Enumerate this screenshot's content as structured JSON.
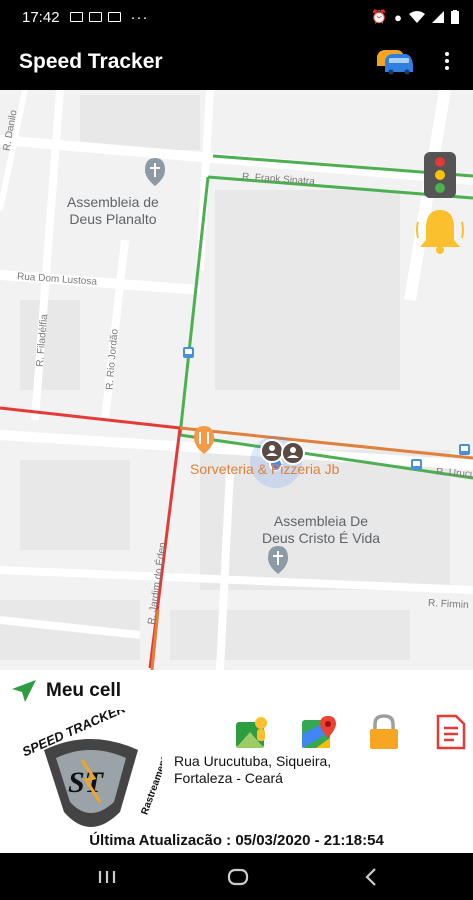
{
  "status_bar": {
    "time": "17:42",
    "more": "···"
  },
  "app_bar": {
    "title": "Speed Tracker",
    "actions": [
      "cars-icon",
      "more-vert-icon"
    ]
  },
  "map": {
    "places": [
      {
        "name": "Assembleia de Deus Planalto",
        "line1": "Assembleia de",
        "line2": "Deus Planalto"
      },
      {
        "name": "Assembleia De Deus Cristo É Vida",
        "line1": "Assembleia De",
        "line2": "Deus Cristo É Vida"
      },
      {
        "name": "Sorveteria & Pizzeria Jb",
        "line1": "Sorveteria & Pizzeria Jb"
      }
    ],
    "streets": [
      "R. Frank Sinatra",
      "Rua Dom Lustosa",
      "R. Filadélfia",
      "R. Rio Jordão",
      "R. Jardim do Éden",
      "R. Urucu",
      "R. Firmin",
      "R. Danilo"
    ],
    "overlays": [
      "traffic-light-icon",
      "alert-bell-icon"
    ],
    "colors": {
      "green_route": "#4caf50",
      "red_route": "#e53935",
      "orange_route": "#e0803a",
      "location_dot": "#4285f4"
    }
  },
  "device": {
    "name": "Meu cell",
    "address_line1": "Rua Urucutuba, Siqueira,",
    "address_line2": "Fortaleza - Ceará",
    "last_update": "Última Atualizacão : 05/03/2020 - 21:18:54",
    "actions": [
      "street-view-icon",
      "google-maps-icon",
      "lock-icon",
      "report-icon"
    ]
  },
  "logo": {
    "top": "SPEED TRACKER",
    "side": "Rastreamento",
    "mark": "ST"
  },
  "nav_bar": [
    "recents-icon",
    "home-icon",
    "back-icon"
  ]
}
